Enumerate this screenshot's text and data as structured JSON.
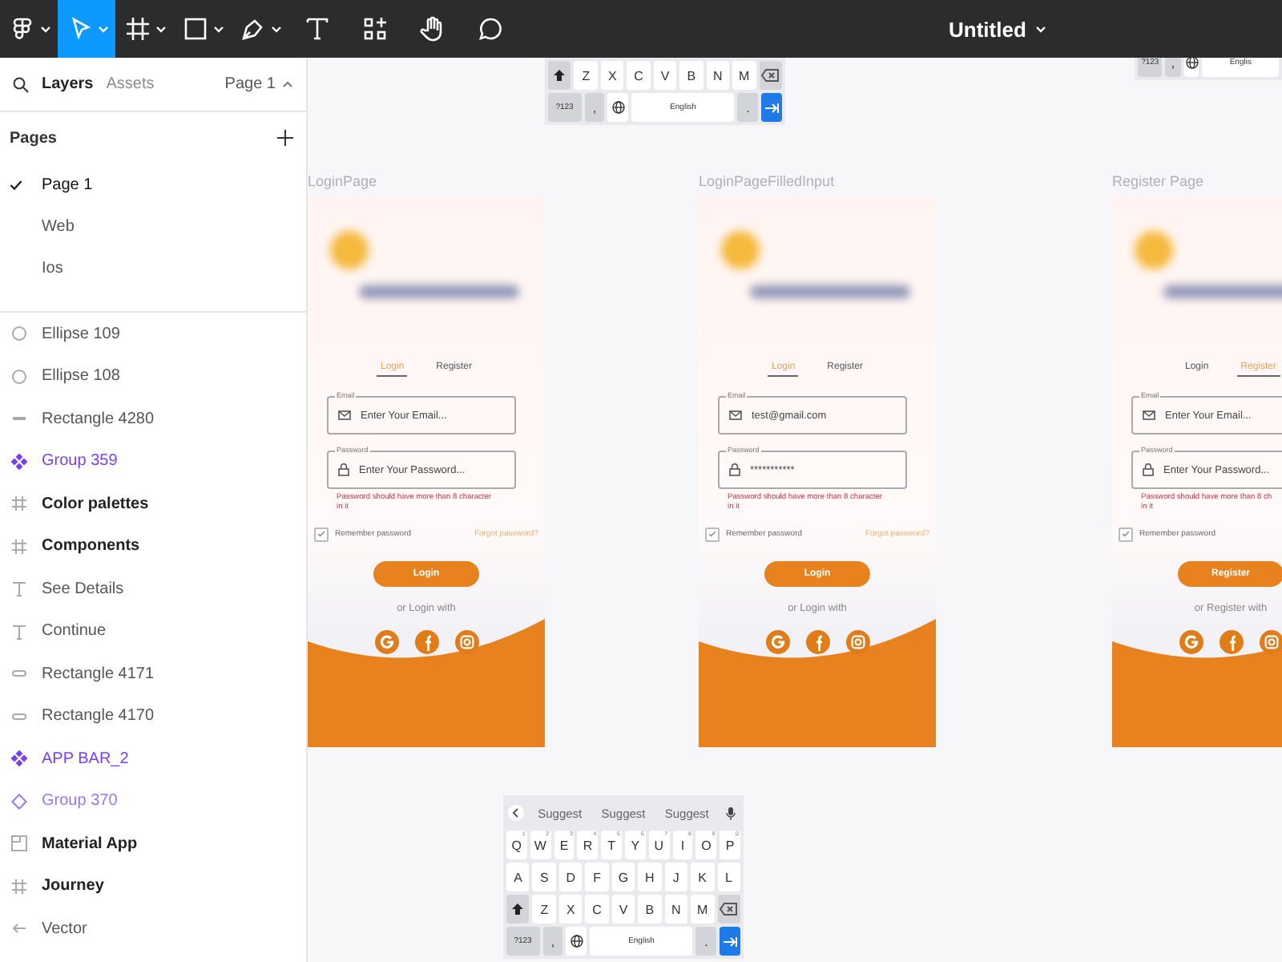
{
  "toolbar": {
    "tools": [
      {
        "kind": "menu",
        "selected": false
      },
      {
        "kind": "move",
        "selected": true
      },
      {
        "kind": "frame",
        "selected": false
      },
      {
        "kind": "shape",
        "selected": false
      },
      {
        "kind": "pen",
        "selected": false
      },
      {
        "kind": "text",
        "selected": false
      },
      {
        "kind": "resources",
        "selected": false
      },
      {
        "kind": "hand",
        "selected": false
      },
      {
        "kind": "comment",
        "selected": false
      }
    ],
    "title": "Untitled"
  },
  "sidebar": {
    "tabs": [
      {
        "label": "Layers",
        "selected": true
      },
      {
        "label": "Assets",
        "selected": false
      }
    ],
    "page_selector": "Page 1",
    "pages_heading": "Pages",
    "pages": [
      {
        "label": "Page 1",
        "selected": true
      },
      {
        "label": "Web",
        "selected": false
      },
      {
        "label": "Ios",
        "selected": false
      }
    ],
    "layers": [
      {
        "name": "Ellipse 109",
        "kind": "ellipse"
      },
      {
        "name": "Ellipse 108",
        "kind": "ellipse"
      },
      {
        "name": "Rectangle 4280",
        "kind": "line"
      },
      {
        "name": "Group 359",
        "kind": "component"
      },
      {
        "name": "Color palettes",
        "kind": "frame"
      },
      {
        "name": "Components",
        "kind": "frame"
      },
      {
        "name": "See Details",
        "kind": "text"
      },
      {
        "name": "Continue",
        "kind": "text"
      },
      {
        "name": "Rectangle 4171",
        "kind": "rectangle"
      },
      {
        "name": "Rectangle 4170",
        "kind": "rectangle"
      },
      {
        "name": "APP BAR_2",
        "kind": "component"
      },
      {
        "name": "Group 370",
        "kind": "instance"
      },
      {
        "name": "Material App",
        "kind": "screen"
      },
      {
        "name": "Journey",
        "kind": "frame"
      },
      {
        "name": "Vector",
        "kind": "vector"
      }
    ]
  },
  "canvas": {
    "frames": [
      {
        "title": "LoginPage",
        "tabs": [
          {
            "label": "Login",
            "selected": true
          },
          {
            "label": "Register",
            "selected": false
          }
        ],
        "fields": [
          {
            "kind": "email",
            "label": "Email",
            "placeholder": "Enter Your Email..."
          },
          {
            "kind": "password",
            "label": "Password",
            "placeholder": "Enter Your Password..."
          }
        ],
        "error": [
          "Password should have more than 8 character",
          "in it"
        ],
        "remember": {
          "label": "Remember password",
          "checked": true
        },
        "forgot": "Forgot password?",
        "button": "Login",
        "alt": "or Login with"
      },
      {
        "title": "LoginPageFilledInput",
        "tabs": [
          {
            "label": "Login",
            "selected": true
          },
          {
            "label": "Register",
            "selected": false
          }
        ],
        "fields": [
          {
            "kind": "email",
            "label": "Email",
            "value": "test@gmail.com"
          },
          {
            "kind": "password",
            "label": "Password",
            "value": "***********"
          }
        ],
        "error": [
          "Password should have more than 8 character",
          "in it"
        ],
        "remember": {
          "label": "Remember password",
          "checked": true
        },
        "forgot": "Forgot password?",
        "button": "Login",
        "alt": "or Login with"
      },
      {
        "title": "Register Page",
        "tabs": [
          {
            "label": "Login",
            "selected": false
          },
          {
            "label": "Register",
            "selected": true
          }
        ],
        "fields": [
          {
            "kind": "email",
            "label": "Email",
            "placeholder": "Enter Your Email..."
          },
          {
            "kind": "password",
            "label": "Password",
            "placeholder": "Enter Your Password..."
          }
        ],
        "error": [
          "Password should have more than 8 ch",
          "in it"
        ],
        "remember": {
          "label": "Remember password",
          "checked": true
        },
        "button": "Register",
        "alt": "or Register with"
      }
    ],
    "keyboards": [
      {
        "rows": [
          {
            "keys": [
              {
                "kind": "shift"
              },
              {
                "kind": "letter",
                "label": "Z"
              },
              {
                "kind": "letter",
                "label": "X"
              },
              {
                "kind": "letter",
                "label": "C"
              },
              {
                "kind": "letter",
                "label": "V"
              },
              {
                "kind": "letter",
                "label": "B"
              },
              {
                "kind": "letter",
                "label": "N"
              },
              {
                "kind": "letter",
                "label": "M"
              },
              {
                "kind": "backspace"
              }
            ]
          },
          {
            "keys": [
              {
                "kind": "numbers",
                "label": "?123"
              },
              {
                "kind": "emoji",
                "label": ","
              },
              {
                "kind": "globe"
              },
              {
                "kind": "space",
                "label": "English"
              },
              {
                "kind": "period",
                "label": "."
              },
              {
                "kind": "return"
              }
            ]
          }
        ]
      },
      {
        "rows": [
          {
            "keys": [
              {
                "kind": "numbers",
                "label": "?123"
              },
              {
                "kind": "emoji",
                "label": ","
              },
              {
                "kind": "globe"
              },
              {
                "kind": "space",
                "label": "Englis"
              }
            ]
          }
        ]
      },
      {
        "rows": [
          {
            "keys": [
              {
                "kind": "back"
              },
              {
                "kind": "suggest",
                "label": "Suggest"
              },
              {
                "kind": "suggest",
                "label": "Suggest"
              },
              {
                "kind": "suggest",
                "label": "Suggest"
              },
              {
                "kind": "mic"
              }
            ]
          },
          {
            "keys": [
              {
                "kind": "letter",
                "label": "Q",
                "hint": "1"
              },
              {
                "kind": "letter",
                "label": "W",
                "hint": "2"
              },
              {
                "kind": "letter",
                "label": "E",
                "hint": "3"
              },
              {
                "kind": "letter",
                "label": "R",
                "hint": "4"
              },
              {
                "kind": "letter",
                "label": "T",
                "hint": "5"
              },
              {
                "kind": "letter",
                "label": "Y",
                "hint": "6"
              },
              {
                "kind": "letter",
                "label": "U",
                "hint": "7"
              },
              {
                "kind": "letter",
                "label": "I",
                "hint": "8"
              },
              {
                "kind": "letter",
                "label": "O",
                "hint": "9"
              },
              {
                "kind": "letter",
                "label": "P",
                "hint": "0"
              }
            ]
          },
          {
            "keys": [
              {
                "kind": "letter",
                "label": "A"
              },
              {
                "kind": "letter",
                "label": "S"
              },
              {
                "kind": "letter",
                "label": "D"
              },
              {
                "kind": "letter",
                "label": "F"
              },
              {
                "kind": "letter",
                "label": "G"
              },
              {
                "kind": "letter",
                "label": "H"
              },
              {
                "kind": "letter",
                "label": "J"
              },
              {
                "kind": "letter",
                "label": "K"
              },
              {
                "kind": "letter",
                "label": "L"
              }
            ]
          },
          {
            "keys": [
              {
                "kind": "shift"
              },
              {
                "kind": "letter",
                "label": "Z"
              },
              {
                "kind": "letter",
                "label": "X"
              },
              {
                "kind": "letter",
                "label": "C"
              },
              {
                "kind": "letter",
                "label": "V"
              },
              {
                "kind": "letter",
                "label": "B"
              },
              {
                "kind": "letter",
                "label": "N"
              },
              {
                "kind": "letter",
                "label": "M"
              },
              {
                "kind": "backspace"
              }
            ]
          },
          {
            "keys": [
              {
                "kind": "numbers",
                "label": "?123"
              },
              {
                "kind": "emoji",
                "label": ","
              },
              {
                "kind": "globe"
              },
              {
                "kind": "space",
                "label": "English"
              },
              {
                "kind": "period",
                "label": "."
              },
              {
                "kind": "return"
              }
            ]
          }
        ]
      }
    ]
  }
}
